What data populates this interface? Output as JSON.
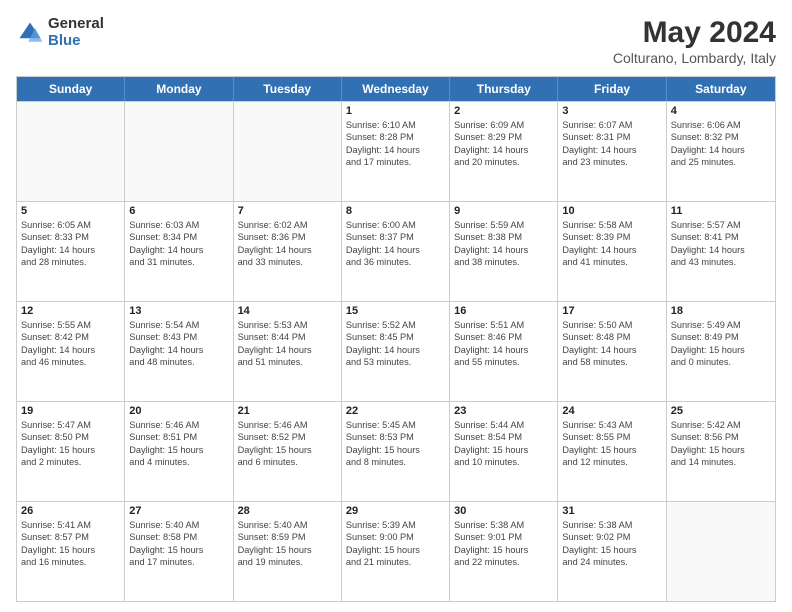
{
  "header": {
    "logo_general": "General",
    "logo_blue": "Blue",
    "title": "May 2024",
    "subtitle": "Colturano, Lombardy, Italy"
  },
  "days_of_week": [
    "Sunday",
    "Monday",
    "Tuesday",
    "Wednesday",
    "Thursday",
    "Friday",
    "Saturday"
  ],
  "weeks": [
    [
      {
        "day": "",
        "text": ""
      },
      {
        "day": "",
        "text": ""
      },
      {
        "day": "",
        "text": ""
      },
      {
        "day": "1",
        "text": "Sunrise: 6:10 AM\nSunset: 8:28 PM\nDaylight: 14 hours\nand 17 minutes."
      },
      {
        "day": "2",
        "text": "Sunrise: 6:09 AM\nSunset: 8:29 PM\nDaylight: 14 hours\nand 20 minutes."
      },
      {
        "day": "3",
        "text": "Sunrise: 6:07 AM\nSunset: 8:31 PM\nDaylight: 14 hours\nand 23 minutes."
      },
      {
        "day": "4",
        "text": "Sunrise: 6:06 AM\nSunset: 8:32 PM\nDaylight: 14 hours\nand 25 minutes."
      }
    ],
    [
      {
        "day": "5",
        "text": "Sunrise: 6:05 AM\nSunset: 8:33 PM\nDaylight: 14 hours\nand 28 minutes."
      },
      {
        "day": "6",
        "text": "Sunrise: 6:03 AM\nSunset: 8:34 PM\nDaylight: 14 hours\nand 31 minutes."
      },
      {
        "day": "7",
        "text": "Sunrise: 6:02 AM\nSunset: 8:36 PM\nDaylight: 14 hours\nand 33 minutes."
      },
      {
        "day": "8",
        "text": "Sunrise: 6:00 AM\nSunset: 8:37 PM\nDaylight: 14 hours\nand 36 minutes."
      },
      {
        "day": "9",
        "text": "Sunrise: 5:59 AM\nSunset: 8:38 PM\nDaylight: 14 hours\nand 38 minutes."
      },
      {
        "day": "10",
        "text": "Sunrise: 5:58 AM\nSunset: 8:39 PM\nDaylight: 14 hours\nand 41 minutes."
      },
      {
        "day": "11",
        "text": "Sunrise: 5:57 AM\nSunset: 8:41 PM\nDaylight: 14 hours\nand 43 minutes."
      }
    ],
    [
      {
        "day": "12",
        "text": "Sunrise: 5:55 AM\nSunset: 8:42 PM\nDaylight: 14 hours\nand 46 minutes."
      },
      {
        "day": "13",
        "text": "Sunrise: 5:54 AM\nSunset: 8:43 PM\nDaylight: 14 hours\nand 48 minutes."
      },
      {
        "day": "14",
        "text": "Sunrise: 5:53 AM\nSunset: 8:44 PM\nDaylight: 14 hours\nand 51 minutes."
      },
      {
        "day": "15",
        "text": "Sunrise: 5:52 AM\nSunset: 8:45 PM\nDaylight: 14 hours\nand 53 minutes."
      },
      {
        "day": "16",
        "text": "Sunrise: 5:51 AM\nSunset: 8:46 PM\nDaylight: 14 hours\nand 55 minutes."
      },
      {
        "day": "17",
        "text": "Sunrise: 5:50 AM\nSunset: 8:48 PM\nDaylight: 14 hours\nand 58 minutes."
      },
      {
        "day": "18",
        "text": "Sunrise: 5:49 AM\nSunset: 8:49 PM\nDaylight: 15 hours\nand 0 minutes."
      }
    ],
    [
      {
        "day": "19",
        "text": "Sunrise: 5:47 AM\nSunset: 8:50 PM\nDaylight: 15 hours\nand 2 minutes."
      },
      {
        "day": "20",
        "text": "Sunrise: 5:46 AM\nSunset: 8:51 PM\nDaylight: 15 hours\nand 4 minutes."
      },
      {
        "day": "21",
        "text": "Sunrise: 5:46 AM\nSunset: 8:52 PM\nDaylight: 15 hours\nand 6 minutes."
      },
      {
        "day": "22",
        "text": "Sunrise: 5:45 AM\nSunset: 8:53 PM\nDaylight: 15 hours\nand 8 minutes."
      },
      {
        "day": "23",
        "text": "Sunrise: 5:44 AM\nSunset: 8:54 PM\nDaylight: 15 hours\nand 10 minutes."
      },
      {
        "day": "24",
        "text": "Sunrise: 5:43 AM\nSunset: 8:55 PM\nDaylight: 15 hours\nand 12 minutes."
      },
      {
        "day": "25",
        "text": "Sunrise: 5:42 AM\nSunset: 8:56 PM\nDaylight: 15 hours\nand 14 minutes."
      }
    ],
    [
      {
        "day": "26",
        "text": "Sunrise: 5:41 AM\nSunset: 8:57 PM\nDaylight: 15 hours\nand 16 minutes."
      },
      {
        "day": "27",
        "text": "Sunrise: 5:40 AM\nSunset: 8:58 PM\nDaylight: 15 hours\nand 17 minutes."
      },
      {
        "day": "28",
        "text": "Sunrise: 5:40 AM\nSunset: 8:59 PM\nDaylight: 15 hours\nand 19 minutes."
      },
      {
        "day": "29",
        "text": "Sunrise: 5:39 AM\nSunset: 9:00 PM\nDaylight: 15 hours\nand 21 minutes."
      },
      {
        "day": "30",
        "text": "Sunrise: 5:38 AM\nSunset: 9:01 PM\nDaylight: 15 hours\nand 22 minutes."
      },
      {
        "day": "31",
        "text": "Sunrise: 5:38 AM\nSunset: 9:02 PM\nDaylight: 15 hours\nand 24 minutes."
      },
      {
        "day": "",
        "text": ""
      }
    ]
  ]
}
